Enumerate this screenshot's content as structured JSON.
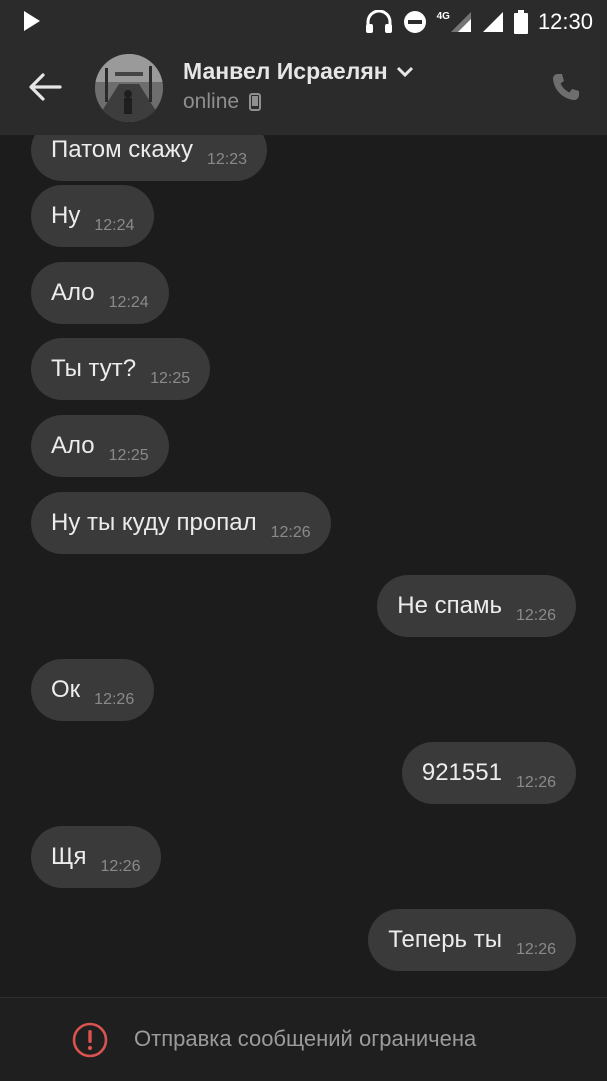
{
  "status_bar": {
    "time": "12:30",
    "network": "4G"
  },
  "header": {
    "name": "Манвел Исраелян",
    "status": "online"
  },
  "messages": [
    {
      "text": "Патом скажу",
      "time": "12:23",
      "dir": "in"
    },
    {
      "text": "Ну",
      "time": "12:24",
      "dir": "in"
    },
    {
      "text": "Ало",
      "time": "12:24",
      "dir": "in"
    },
    {
      "text": "Ты тут?",
      "time": "12:25",
      "dir": "in"
    },
    {
      "text": "Ало",
      "time": "12:25",
      "dir": "in"
    },
    {
      "text": "Ну ты куду пропал",
      "time": "12:26",
      "dir": "in"
    },
    {
      "text": "Не спамь",
      "time": "12:26",
      "dir": "out"
    },
    {
      "text": "Ок",
      "time": "12:26",
      "dir": "in"
    },
    {
      "text": "921551",
      "time": "12:26",
      "dir": "out"
    },
    {
      "text": "Щя",
      "time": "12:26",
      "dir": "in"
    },
    {
      "text": "Теперь ты",
      "time": "12:26",
      "dir": "out"
    }
  ],
  "footer": {
    "text": "Отправка сообщений ограничена"
  }
}
